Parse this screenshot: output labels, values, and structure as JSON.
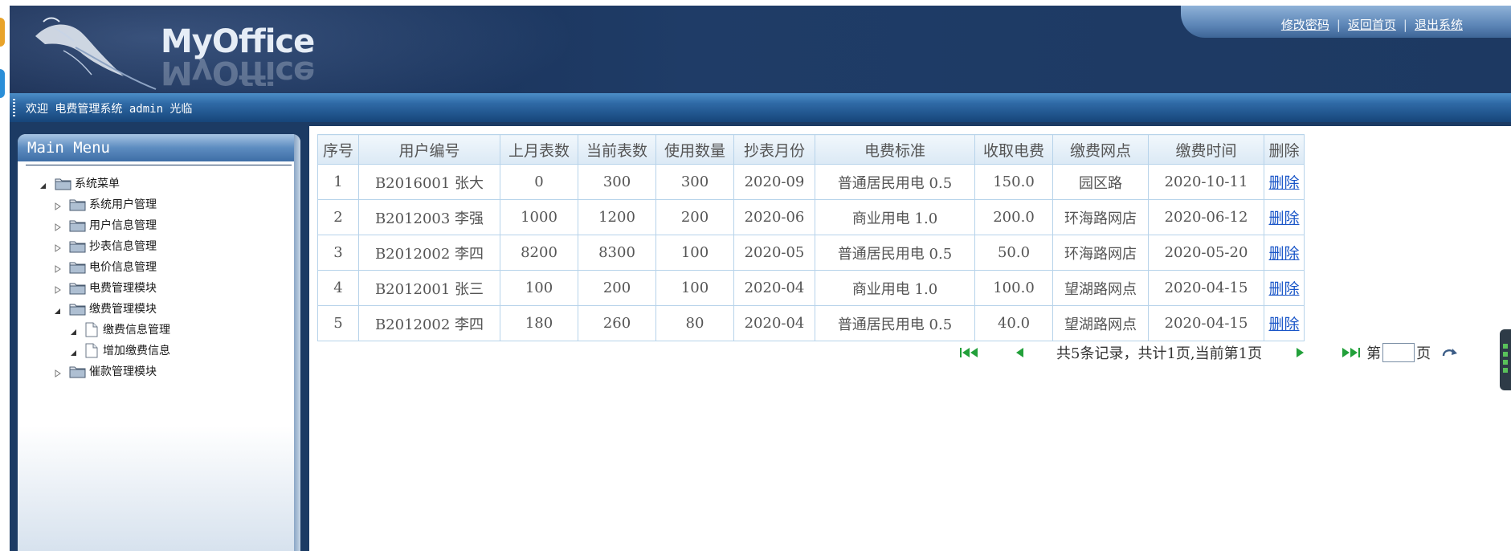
{
  "app": {
    "logo_text": "MyOffice",
    "welcome": "欢迎 电费管理系统 admin 光临"
  },
  "top_links": [
    "修改密码",
    "返回首页",
    "退出系统"
  ],
  "sidebar": {
    "title": "Main Menu",
    "tree": [
      {
        "label": "系统菜单",
        "level": 0,
        "expanded": true,
        "type": "folder"
      },
      {
        "label": "系统用户管理",
        "level": 1,
        "expanded": false,
        "type": "folder"
      },
      {
        "label": "用户信息管理",
        "level": 1,
        "expanded": false,
        "type": "folder"
      },
      {
        "label": "抄表信息管理",
        "level": 1,
        "expanded": false,
        "type": "folder"
      },
      {
        "label": "电价信息管理",
        "level": 1,
        "expanded": false,
        "type": "folder"
      },
      {
        "label": "电费管理模块",
        "level": 1,
        "expanded": false,
        "type": "folder"
      },
      {
        "label": "缴费管理模块",
        "level": 1,
        "expanded": true,
        "type": "folder"
      },
      {
        "label": "缴费信息管理",
        "level": 2,
        "type": "doc"
      },
      {
        "label": "增加缴费信息",
        "level": 2,
        "type": "doc"
      },
      {
        "label": "催款管理模块",
        "level": 1,
        "expanded": false,
        "type": "folder"
      }
    ]
  },
  "table": {
    "columns": [
      "序号",
      "用户编号",
      "上月表数",
      "当前表数",
      "使用数量",
      "抄表月份",
      "电费标准",
      "收取电费",
      "缴费网点",
      "缴费时间",
      "删除"
    ],
    "rows": [
      [
        "1",
        "B2016001 张大",
        "0",
        "300",
        "300",
        "2020-09",
        "普通居民用电 0.5",
        "150.0",
        "园区路",
        "2020-10-11",
        "删除"
      ],
      [
        "2",
        "B2012003 李强",
        "1000",
        "1200",
        "200",
        "2020-06",
        "商业用电 1.0",
        "200.0",
        "环海路网店",
        "2020-06-12",
        "删除"
      ],
      [
        "3",
        "B2012002 李四",
        "8200",
        "8300",
        "100",
        "2020-05",
        "普通居民用电 0.5",
        "50.0",
        "环海路网店",
        "2020-05-20",
        "删除"
      ],
      [
        "4",
        "B2012001 张三",
        "100",
        "200",
        "100",
        "2020-04",
        "商业用电 1.0",
        "100.0",
        "望湖路网点",
        "2020-04-15",
        "删除"
      ],
      [
        "5",
        "B2012002 李四",
        "180",
        "260",
        "80",
        "2020-04",
        "普通居民用电 0.5",
        "40.0",
        "望湖路网点",
        "2020-04-15",
        "删除"
      ]
    ]
  },
  "pager": {
    "info": "共5条记录，共计1页,当前第1页",
    "goto_prefix": "第",
    "goto_suffix": "页",
    "page_value": ""
  },
  "icons": {
    "first": "first-page-icon",
    "prev": "prev-page-icon",
    "next": "next-page-icon",
    "last": "last-page-icon",
    "go": "refresh-go-icon",
    "folder": "folder-icon",
    "doc": "document-icon"
  },
  "colors": {
    "header_dark": "#15294d",
    "welcome_bar": "#2f6aa6",
    "table_border": "#b7d3ea",
    "link": "#1a56c8",
    "pager_arrow": "#22a03a"
  }
}
